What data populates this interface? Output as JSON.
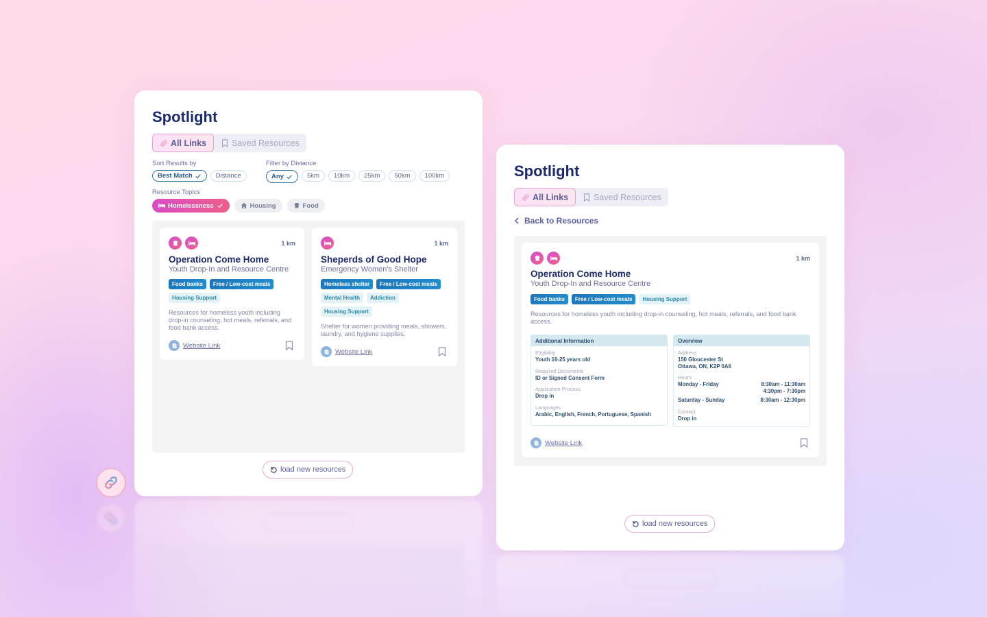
{
  "app_title": "Spotlight",
  "tabs": [
    {
      "label": "All Links",
      "icon": "link-icon",
      "active": true
    },
    {
      "label": "Saved Resources",
      "icon": "bookmark-icon",
      "active": false
    }
  ],
  "left_panel": {
    "sort": {
      "label": "Sort Results by",
      "options": [
        {
          "label": "Best Match",
          "selected": true
        },
        {
          "label": "Distance",
          "selected": false
        }
      ]
    },
    "distance_filter": {
      "label": "Filter by Distance",
      "options": [
        {
          "label": "Any",
          "selected": true
        },
        {
          "label": "5km",
          "selected": false
        },
        {
          "label": "10km",
          "selected": false
        },
        {
          "label": "25km",
          "selected": false
        },
        {
          "label": "50km",
          "selected": false
        },
        {
          "label": "100km",
          "selected": false
        }
      ]
    },
    "topics": {
      "label": "Resource Topics",
      "options": [
        {
          "label": "Homelessness",
          "icon": "bed-icon",
          "selected": true
        },
        {
          "label": "Housing",
          "icon": "house-icon",
          "selected": false
        },
        {
          "label": "Food",
          "icon": "food-icon",
          "selected": false
        }
      ]
    },
    "results": [
      {
        "name": "Operation Come Home",
        "subtitle": "Youth Drop-In and Resource Centre",
        "distance": "1 km",
        "category_icons": [
          "food-icon",
          "bed-icon"
        ],
        "tags_primary": [
          "Food banks",
          "Free / Low-cost meals"
        ],
        "tags_secondary": [
          "Housing Support"
        ],
        "description": "Resources for homeless youth including drop-in counseling, hot meals, referrals, and food bank access.",
        "link_label": "Website Link"
      },
      {
        "name": "Sheperds of Good Hope",
        "subtitle": "Emergency Women's Shelter",
        "distance": "1 km",
        "category_icons": [
          "bed-icon"
        ],
        "tags_primary": [
          "Homeless shelter",
          "Free / Low-cost meals"
        ],
        "tags_secondary": [
          "Mental Health",
          "Addiction",
          "Housing Support"
        ],
        "description": "Shelter for women providing meals, showers, laundry, and hygiene supplies.",
        "link_label": "Website Link"
      }
    ],
    "load_button": "load new resources"
  },
  "right_panel": {
    "back_label": "Back to Resources",
    "detail": {
      "name": "Operation Come Home",
      "subtitle": "Youth Drop-In and Resource Centre",
      "distance": "1 km",
      "category_icons": [
        "food-icon",
        "bed-icon"
      ],
      "tags_primary": [
        "Food banks",
        "Free / Low-cost meals"
      ],
      "tags_secondary": [
        "Housing Support"
      ],
      "description": "Resources for homeless youth including drop-in counseling, hot meals, referrals, and food bank access.",
      "additional_info": {
        "heading": "Additional Information",
        "fields": [
          {
            "label": "Eligibility",
            "value": "Youth 16-25 years old"
          },
          {
            "label": "Required Documents",
            "value": "ID or Signed Consent Form"
          },
          {
            "label": "Application Process",
            "value": "Drop in"
          },
          {
            "label": "Languages",
            "value": "Arabic, English, French, Portuguese, Spanish"
          }
        ]
      },
      "overview": {
        "heading": "Overview",
        "address_label": "Address",
        "address_line1": "150 Gloucester St",
        "address_line2": "Ottawa, ON, K2P 0A6",
        "hours_label": "Hours",
        "hours": [
          {
            "days": "Monday - Friday",
            "time1": "8:30am - 11:30am",
            "time2": "4:30pm - 7:30pm"
          },
          {
            "days": "Saturday - Sunday",
            "time1": "8:30am - 12:30pm",
            "time2": ""
          }
        ],
        "contact_label": "Contact",
        "contact_value": "Drop in"
      },
      "link_label": "Website Link"
    },
    "load_button": "load new resources"
  },
  "side_buttons": [
    {
      "icon": "link-icon",
      "active": true
    }
  ],
  "colors": {
    "title": "#1b2a6b",
    "accent_pink": "#e6a2d7",
    "topic_gradient_start": "#d84cc4",
    "topic_gradient_end": "#ef5e88",
    "tag_primary": "#1f76bb",
    "tag_secondary_bg": "#e2f2f6"
  }
}
